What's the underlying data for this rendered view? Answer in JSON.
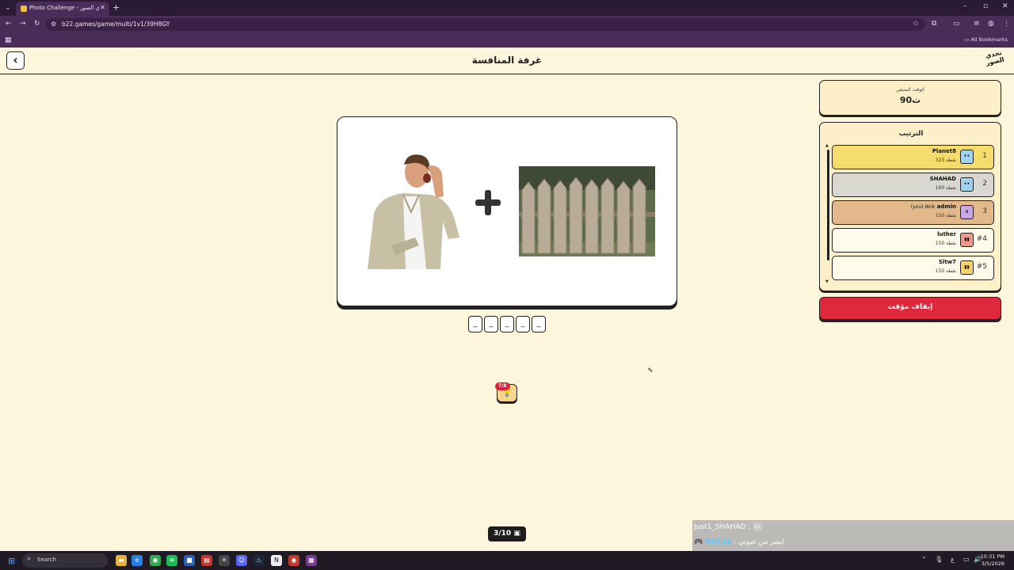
{
  "browser": {
    "tab_title": "Photo Challenge - تحدي الصور",
    "url": "b22.games/game/multi/1v1/39H8GY",
    "all_bookmarks": "All Bookmarks"
  },
  "header": {
    "title": "غرفة المنافسة",
    "logo_text": "تحدي الصور"
  },
  "puzzle": {
    "slots": [
      "_",
      "_",
      "_",
      "_",
      "_"
    ],
    "hint_badge": "7/8"
  },
  "round": {
    "label": "3/10"
  },
  "sidebar": {
    "timer_label": "الوقت المتبقي",
    "timer_value": "90ث",
    "ranking_title": "الترتيب",
    "players": [
      {
        "name": "Planet8",
        "you": "",
        "score": "323 نقطة",
        "pos": "1",
        "color": "#f6dd6b",
        "avatar_color": "#9fd3f2"
      },
      {
        "name": "SHAHAD",
        "you": "",
        "score": "160 نقطة",
        "pos": "2",
        "color": "#d8d8d0",
        "avatar_color": "#9fd3f2"
      },
      {
        "name": "admin",
        "you": "(you) i6nk",
        "score": "150 نقطة",
        "pos": "3",
        "color": "#e3b98b",
        "avatar_color": "#c9a6e6"
      },
      {
        "name": "luther",
        "you": "",
        "score": "150 نقطة",
        "pos": "#4",
        "color": "#fffbea",
        "avatar_color": "#f39a8a"
      },
      {
        "name": "Sltw7",
        "you": "",
        "score": "150 نقطة",
        "pos": "#5",
        "color": "#fffbea",
        "avatar_color": "#f5d36a"
      }
    ],
    "stop_button": "إيقاف مؤقت"
  },
  "chat": {
    "line1": "Just1_SHAHAD :",
    "line2_name": "RHF19",
    "line2_text": ": ابشر من عيوني"
  },
  "taskbar": {
    "search_placeholder": "Search",
    "time": "10:31 PM",
    "date": "3/5/2026"
  }
}
